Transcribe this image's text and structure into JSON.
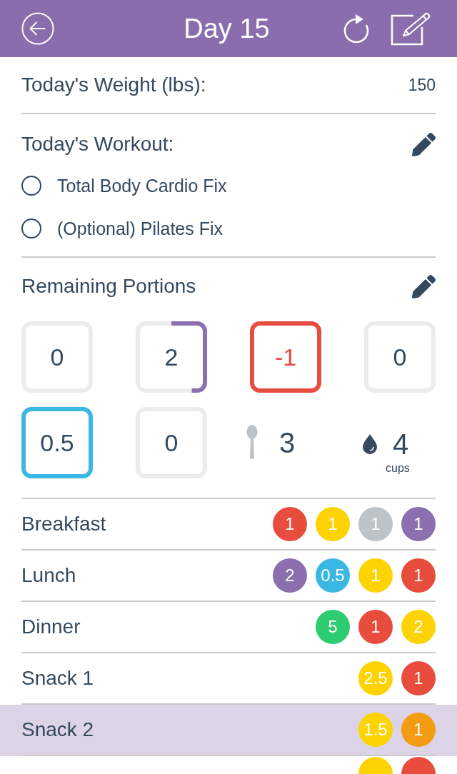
{
  "header": {
    "title": "Day 15"
  },
  "weight": {
    "label": "Today's Weight (lbs):",
    "value": "150"
  },
  "workout": {
    "label": "Today's Workout:",
    "options": [
      {
        "label": "Total Body Cardio Fix",
        "selected": false
      },
      {
        "label": "(Optional) Pilates Fix",
        "selected": false
      }
    ]
  },
  "portions": {
    "label": "Remaining Portions",
    "items": [
      {
        "kind": "container",
        "value": "0",
        "over": false
      },
      {
        "kind": "container",
        "value": "2",
        "level": 0.42,
        "color": "#8b6fae",
        "over": false
      },
      {
        "kind": "container",
        "value": "-1",
        "level": 1,
        "color": "#e74c3c",
        "over": true
      },
      {
        "kind": "container",
        "value": "0",
        "over": false
      },
      {
        "kind": "container",
        "value": "0.5",
        "level": 1,
        "color": "#3bb7e4",
        "over": false
      },
      {
        "kind": "container",
        "value": "0",
        "over": false
      },
      {
        "kind": "teaspoon",
        "value": "3"
      },
      {
        "kind": "water",
        "value": "4",
        "unit": "cups"
      }
    ]
  },
  "meals": {
    "rows": [
      {
        "label": "Breakfast",
        "selected": false,
        "portions": [
          {
            "value": "1",
            "color": "#e74c3c"
          },
          {
            "value": "1",
            "color": "#fed304"
          },
          {
            "value": "1",
            "color": "#bdc3c7"
          },
          {
            "value": "1",
            "color": "#8b6fae"
          }
        ]
      },
      {
        "label": "Lunch",
        "selected": false,
        "portions": [
          {
            "value": "2",
            "color": "#8b6fae"
          },
          {
            "value": "0.5",
            "color": "#3bb7e4"
          },
          {
            "value": "1",
            "color": "#fed304"
          },
          {
            "value": "1",
            "color": "#e74c3c"
          }
        ]
      },
      {
        "label": "Dinner",
        "selected": false,
        "portions": [
          {
            "value": "5",
            "color": "#2ecc71"
          },
          {
            "value": "1",
            "color": "#e74c3c"
          },
          {
            "value": "2",
            "color": "#fed304"
          }
        ]
      },
      {
        "label": "Snack 1",
        "selected": false,
        "portions": [
          {
            "value": "2.5",
            "color": "#fed304"
          },
          {
            "value": "1",
            "color": "#e74c3c"
          }
        ]
      },
      {
        "label": "Snack 2",
        "selected": true,
        "portions": [
          {
            "value": "1.5",
            "color": "#fed304"
          },
          {
            "value": "1",
            "color": "#f39c12"
          }
        ]
      }
    ],
    "partial_row": {
      "portions": [
        {
          "color": "#fed304"
        },
        {
          "color": "#e74c3c"
        }
      ]
    }
  }
}
